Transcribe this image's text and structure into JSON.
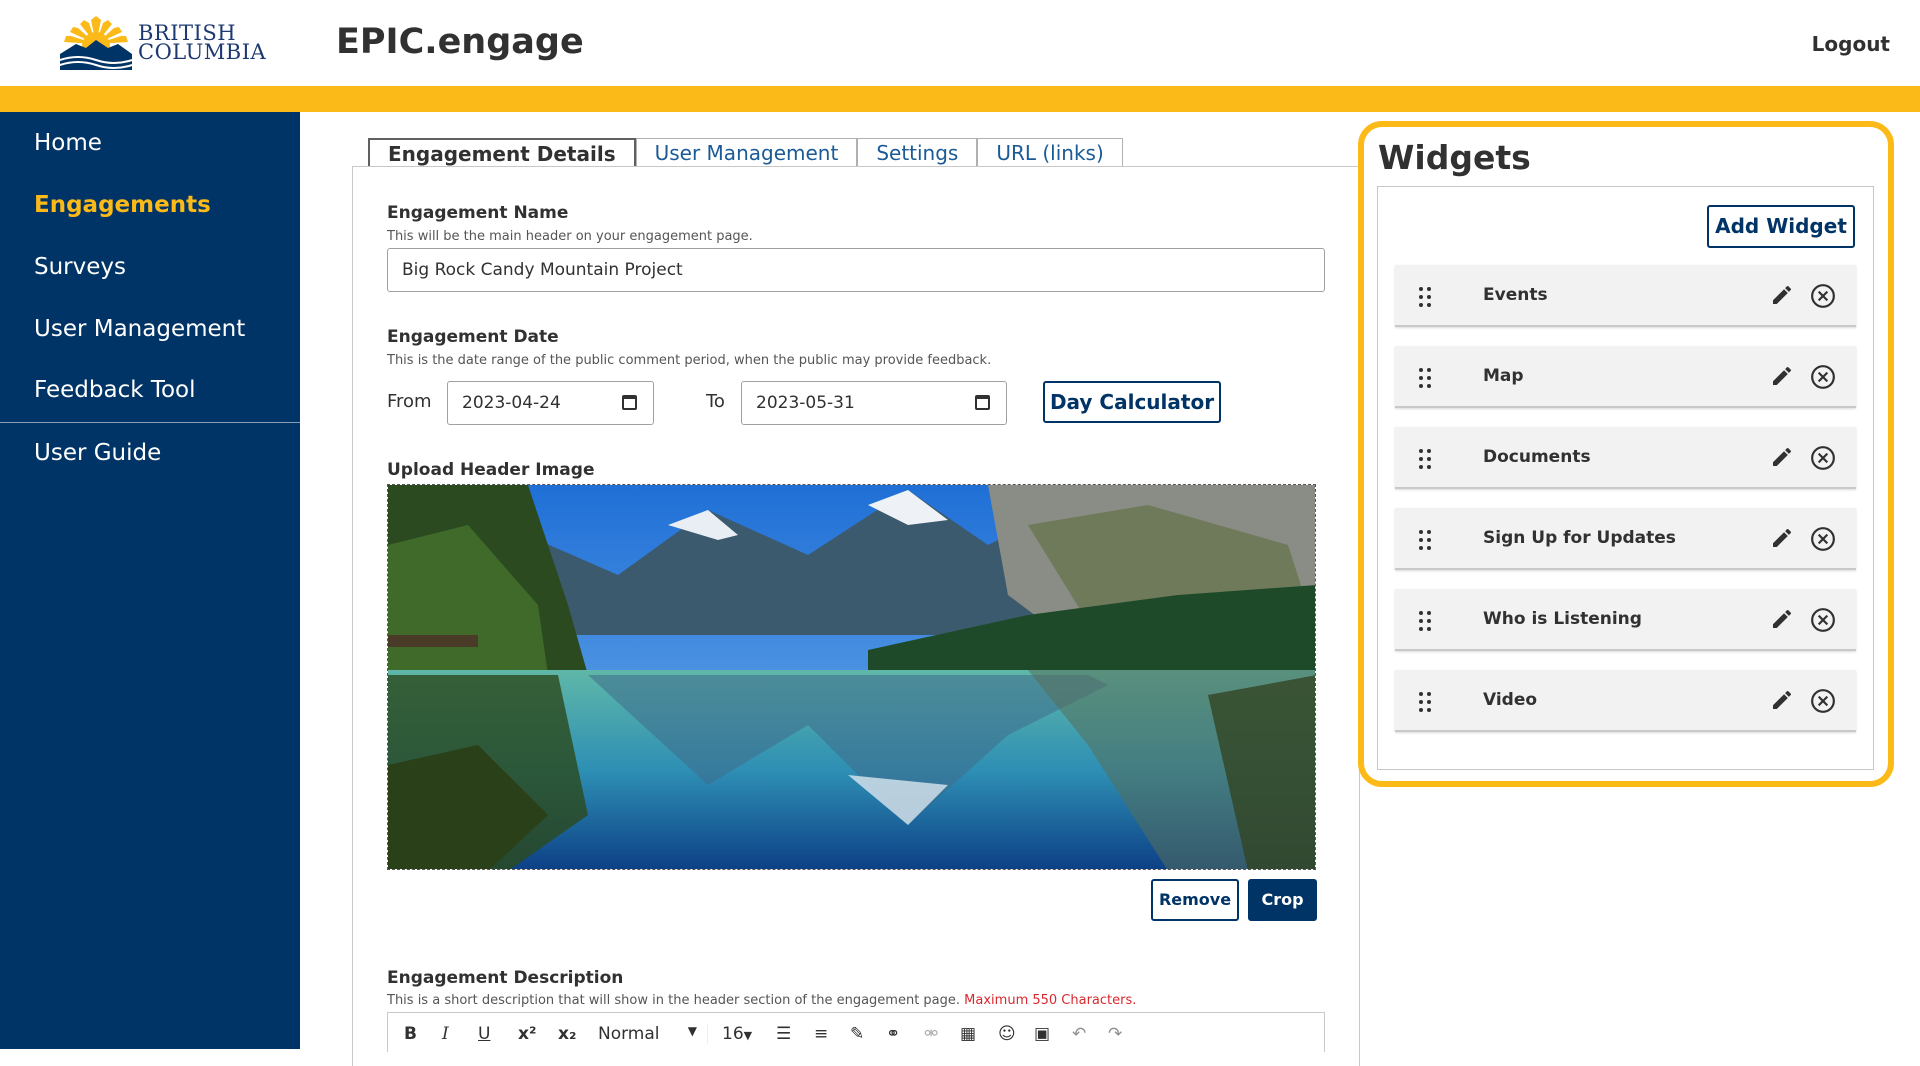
{
  "brand": {
    "logo_line1": "BRITISH",
    "logo_line2": "COLUMBIA",
    "app_title": "EPIC.engage",
    "accent": "#fcba19",
    "navy": "#003366"
  },
  "header": {
    "logout": "Logout"
  },
  "sidebar": {
    "items": [
      {
        "label": "Home"
      },
      {
        "label": "Engagements",
        "active": true
      },
      {
        "label": "Surveys"
      },
      {
        "label": "User Management"
      },
      {
        "label": "Feedback Tool"
      },
      {
        "label": "User Guide"
      }
    ]
  },
  "tabs": [
    {
      "label": "Engagement Details",
      "active": true
    },
    {
      "label": "User Management"
    },
    {
      "label": "Settings"
    },
    {
      "label": "URL (links)"
    }
  ],
  "form": {
    "name_title": "Engagement Name",
    "name_help": "This will be the main header on your engagement page.",
    "name_value": "Big Rock Candy Mountain Project",
    "date_title": "Engagement Date",
    "date_help": "This is the date range of the public comment period, when the public may provide feedback.",
    "from_label": "From",
    "from_value": "2023-04-24",
    "to_label": "To",
    "to_value": "2023-05-31",
    "day_calc": "Day Calculator",
    "image_title": "Upload Header Image",
    "remove": "Remove",
    "crop": "Crop",
    "desc_title": "Engagement Description",
    "desc_help": "This is a short description that will show in the header section of the engagement page.",
    "desc_limit": "Maximum 550 Characters.",
    "toolbar": {
      "bold": "B",
      "italic": "I",
      "underline": "U",
      "superscript": "x²",
      "subscript": "x₂",
      "format": "Normal",
      "size": "16"
    }
  },
  "widgets": {
    "title": "Widgets",
    "add": "Add Widget",
    "items": [
      {
        "label": "Events"
      },
      {
        "label": "Map"
      },
      {
        "label": "Documents"
      },
      {
        "label": "Sign Up for Updates"
      },
      {
        "label": "Who is Listening"
      },
      {
        "label": "Video"
      }
    ]
  }
}
